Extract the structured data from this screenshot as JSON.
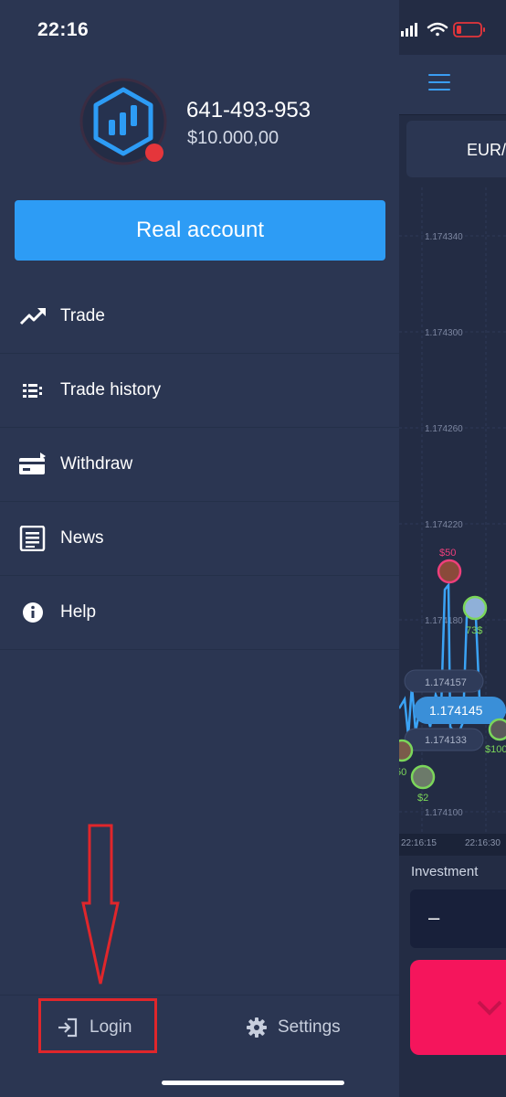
{
  "status_bar": {
    "time": "22:16"
  },
  "account": {
    "id": "641-493-953",
    "balance": "$10.000,00",
    "status_dot_color": "#e5363b"
  },
  "real_account_button": {
    "label": "Real account"
  },
  "menu": {
    "items": [
      {
        "label": "Trade",
        "icon": "trend-up-icon"
      },
      {
        "label": "Trade history",
        "icon": "list-icon"
      },
      {
        "label": "Withdraw",
        "icon": "card-icon"
      },
      {
        "label": "News",
        "icon": "newspaper-icon"
      },
      {
        "label": "Help",
        "icon": "info-icon"
      }
    ]
  },
  "bottom_bar": {
    "login_label": "Login",
    "settings_label": "Settings"
  },
  "trading_panel": {
    "pair": "EUR/",
    "price_levels": [
      "1.174340",
      "1.174300",
      "1.174260",
      "1.174220",
      "1.174180",
      "1.174157",
      "1.174145",
      "1.174133",
      "1.174100"
    ],
    "time_labels": [
      "22:16:15",
      "22:16:30"
    ],
    "trade_badges": [
      "$50",
      "73$",
      "$2",
      "$100",
      "50"
    ],
    "investment_label": "Investment",
    "investment_value": "–"
  },
  "colors": {
    "accent": "#2d9cf5",
    "put": "#f5155c",
    "annotation": "#e0262b"
  }
}
